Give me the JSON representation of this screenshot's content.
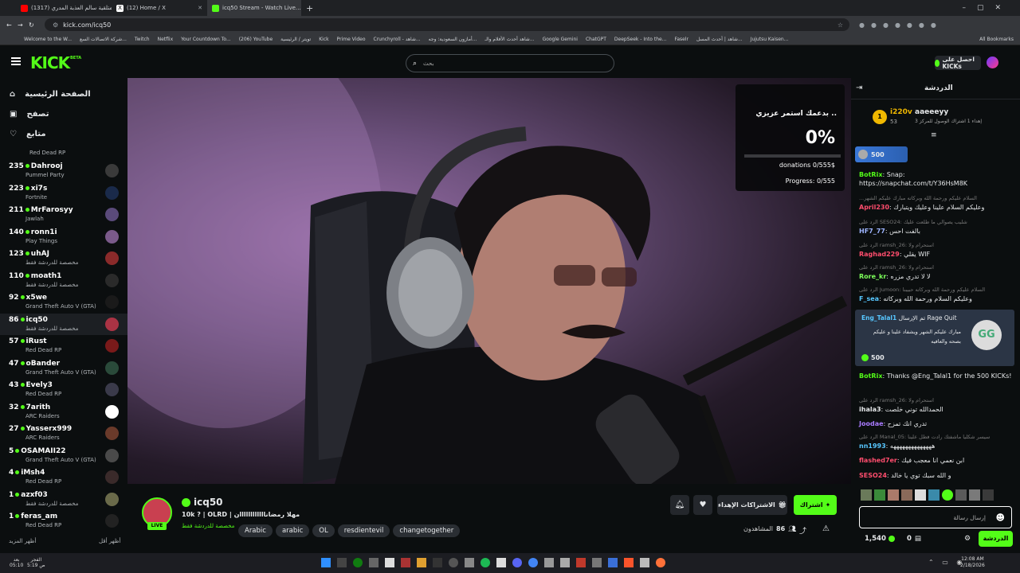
{
  "browser": {
    "tabs": [
      {
        "label": "(1317) متلقية سالم العذبة المدري",
        "color": "#ff0000",
        "active": false
      },
      {
        "label": "(12) Home / X",
        "color": "#ffffff",
        "active": false
      },
      {
        "label": "icq50 Stream - Watch Live...",
        "color": "#53fc18",
        "active": true
      }
    ],
    "url": "kick.com/icq50",
    "bookmarks": [
      "Welcome to the W...",
      "شركة الاتصالات السع...",
      "Twitch",
      "Netflix",
      "Your Countdown To...",
      "(206) YouTube",
      "تويتر / الرئيسية",
      "Kick",
      "Prime Video",
      "Crunchyroll - شاهد...",
      "أمازون السعودية: وجه...",
      "شاهد أحدث الأفلام والـ...",
      "Google Gemini",
      "ChatGPT",
      "DeepSeek - Into the...",
      "Faselr",
      "شاهد | أحدث المسل...",
      "Jujutsu Kaisen..."
    ],
    "all_bookmarks": "All Bookmarks"
  },
  "header": {
    "logo": "KICK",
    "logo_beta": "BETA",
    "search_placeholder": "بحث",
    "get_kicks": "احصل على KICKs"
  },
  "sidebar": {
    "nav": [
      {
        "label": "الصفحة الرئيسية",
        "icon": "home-icon"
      },
      {
        "label": "تصفح",
        "icon": "browse-icon"
      },
      {
        "label": "متابع",
        "icon": "heart-icon"
      }
    ],
    "top_partial": "Red Dead RP",
    "channels": [
      {
        "viewers": "235",
        "name": "Dahrooj",
        "game": "Pummel Party",
        "avatar": "#3a3a3a"
      },
      {
        "viewers": "223",
        "name": "xi7s",
        "game": "Fortnite",
        "avatar": "#1a2a4a"
      },
      {
        "viewers": "211",
        "name": "MrFarosyy",
        "game": "Jawlah",
        "avatar": "#5a4a7a"
      },
      {
        "viewers": "140",
        "name": "ronn1i",
        "game": "Play Things",
        "avatar": "#7a5a8a"
      },
      {
        "viewers": "123",
        "name": "uhAJ",
        "game": "مخصصة للدردشة فقط",
        "avatar": "#8a2a2a"
      },
      {
        "viewers": "110",
        "name": "moath1",
        "game": "مخصصة للدردشة فقط",
        "avatar": "#2a2a2a"
      },
      {
        "viewers": "92",
        "name": "x5we",
        "game": "Grand Theft Auto V (GTA)",
        "avatar": "#1a1a1a"
      },
      {
        "viewers": "86",
        "name": "icq50",
        "game": "مخصصة للدردشة فقط",
        "avatar": "#aa3344"
      },
      {
        "viewers": "57",
        "name": "iRust",
        "game": "Red Dead RP",
        "avatar": "#7a1a1a"
      },
      {
        "viewers": "47",
        "name": "oBander",
        "game": "Grand Theft Auto V (GTA)",
        "avatar": "#2a4a3a"
      },
      {
        "viewers": "43",
        "name": "Evely3",
        "game": "Red Dead RP",
        "avatar": "#3a3a4a"
      },
      {
        "viewers": "32",
        "name": "7arith",
        "game": "ARC Raiders",
        "avatar": "#ffffff"
      },
      {
        "viewers": "27",
        "name": "Yasserx999",
        "game": "ARC Raiders",
        "avatar": "#6a3a2a"
      },
      {
        "viewers": "5",
        "name": "OSAMAII22",
        "game": "Grand Theft Auto V (GTA)",
        "avatar": "#4a4a4a"
      },
      {
        "viewers": "4",
        "name": "iMsh4",
        "game": "Red Dead RP",
        "avatar": "#3a2a2a"
      },
      {
        "viewers": "1",
        "name": "azxf03",
        "game": "مخصصة للدردشة فقط",
        "avatar": "#6a6a4a"
      },
      {
        "viewers": "1",
        "name": "feras_am",
        "game": "Red Dead RP",
        "avatar": "#222222"
      }
    ],
    "show_more": "أظهر المزيد",
    "show_less": "أظهر أقل"
  },
  "overlay": {
    "title": "بدعمك استمر عزيزي ..",
    "percent": "0%",
    "progress_fraction": 0,
    "donations": "donations 0/555$",
    "progress": "Progress: 0/555"
  },
  "stream": {
    "channel": "icq50",
    "live": "LIVE",
    "title": "10k ? | OLRD | مهلا رمضاناااااااااااان",
    "category": "مخصصة للدردشة فقط",
    "tags": [
      "Arabic",
      "arabic",
      "OL",
      "resdientevil",
      "changetogether"
    ],
    "subscribe": "اشتراك",
    "gift_subs": "الاشتراكات الإهداء",
    "viewers_label": "المشاهدون",
    "viewers": "86"
  },
  "chat": {
    "title": "الدردشة",
    "leaderboard": [
      {
        "rank": "1",
        "name": "i220v",
        "sub": "53"
      },
      {
        "rank": "",
        "name": "aaeeeyy",
        "sub": "إهداء 1 اشتراك الوصول للمركز 3"
      }
    ],
    "pinned_amount": "500",
    "messages": [
      {
        "reply": "",
        "user": "BotRix",
        "color": "#53fc18",
        "text": "Snap: https://snapchat.com/t/Y36HsM8K"
      },
      {
        "reply": "...السلام عليكم ورحمة الله وبركاته مبارك عليكم الشهر",
        "user": "April230",
        "color": "#ff4d6d",
        "text": "وعليكم السلام علينا وعليك ويتبارك"
      },
      {
        "reply": "الرد على SESO24: شليب يصوالي ما طلعت عليك",
        "user": "HF7_77",
        "color": "#9db4ff",
        "text": "بالفت احس"
      },
      {
        "reply": "الرد على ramsh_26: استحرام ولا",
        "user": "Raghad229",
        "color": "#ff4d6d",
        "text": "يقلي WIF"
      },
      {
        "reply": "الرد على ramsh_26: استحرام ولا",
        "user": "Rore_kr",
        "color": "#7cff5a",
        "text": "لا لا تدري مزره"
      },
      {
        "reply": "الرد على Jumoon: السلام عليكم ورحمة الله وبركاته حبيبنا",
        "user": "F_sea",
        "color": "#57c7ff",
        "text": "وعليكم السلام ورحمة الله وبركاته"
      }
    ],
    "rage_quit": {
      "user": "Eng_Talal1",
      "action": "تم الإرسال Rage Quit",
      "text": "مبارك عليكم الشهر ويشفاد علينا و عليكم بصحه والعافيه",
      "amount": "500"
    },
    "messages2": [
      {
        "reply": "",
        "user": "BotRix",
        "color": "#53fc18",
        "text": "Thanks @Eng_Talal1 for the 500 KICKs!"
      },
      {
        "reply": "الرد على ramsh_26: استحرام ولا",
        "user": "ihala3",
        "color": "#e6e8ea",
        "text": "الحمدالله توني خلصت"
      },
      {
        "reply": "",
        "user": "Joodae",
        "color": "#a97bff",
        "text": "تدري انك تمزح"
      },
      {
        "reply": "الرد على Manal_05: سيسر شكليا ماشفتك رادت فطل علينا",
        "user": "nn1993",
        "color": "#57c7ff",
        "text": "ههههههههههههههه"
      },
      {
        "reply": "",
        "user": "flashed7er",
        "color": "#ff4d6d",
        "text": "ابن نعمي انا معجب فيك"
      },
      {
        "reply": "",
        "user": "SESO24",
        "color": "#ff4d6d",
        "text": "و الله سبك توي يا خالد"
      }
    ],
    "input_placeholder": "إرسال رسالة",
    "kicks_balance": "1,540",
    "count": "0",
    "chat_button": "الدردشة"
  },
  "taskbar": {
    "weather": "بعد",
    "weather2": "05:10",
    "prayer": "الفجر",
    "prayer_time": "5:19 ص",
    "time": "12:08 AM",
    "date": "2/18/2026"
  }
}
